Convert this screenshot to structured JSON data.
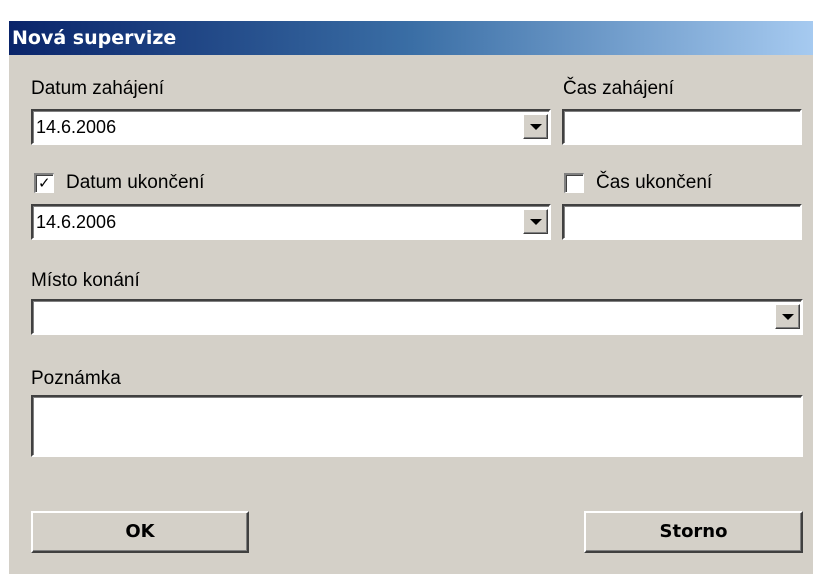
{
  "window": {
    "title": "Nová supervize"
  },
  "start": {
    "date_label": "Datum zahájení",
    "date_value": "14.6.2006",
    "time_label": "Čas zahájení",
    "time_value": ""
  },
  "end": {
    "date_checkbox_checked": true,
    "date_label": "Datum ukončení",
    "date_value": "14.6.2006",
    "time_checkbox_checked": false,
    "time_label": "Čas ukončení",
    "time_value": ""
  },
  "location": {
    "label": "Místo konání",
    "value": ""
  },
  "note": {
    "label": "Poznámka",
    "value": ""
  },
  "buttons": {
    "ok_label": "OK",
    "cancel_label": "Storno"
  },
  "icons": {
    "dropdown": "chevron-down-icon",
    "check": "checkmark-icon"
  },
  "colors": {
    "dialog_bg": "#d4d0c8",
    "title_start": "#0a246a",
    "title_end": "#a6caf0"
  }
}
